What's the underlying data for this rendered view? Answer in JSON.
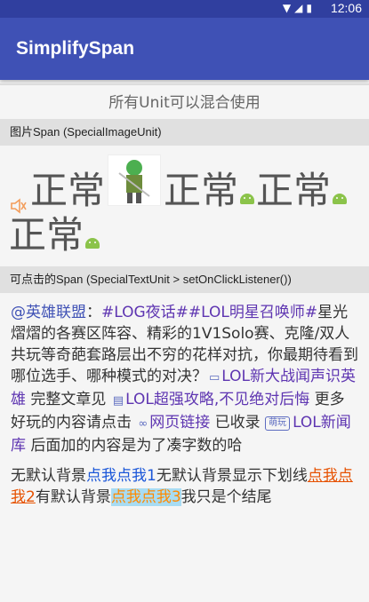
{
  "status_bar": {
    "time": "12:06"
  },
  "app_bar": {
    "title": "SimplifySpan"
  },
  "intro": {
    "text": "所有Unit可以混合使用"
  },
  "sections": {
    "image_span_header": "图片Span (SpecialImageUnit)",
    "image_span": {
      "word": "正常"
    },
    "text_span_header": "可点击的Span (SpecialTextUnit > setOnClickListener())"
  },
  "paragraph1": {
    "tag1": "@英雄联盟",
    "sep1": "：",
    "tag2": "#LOG夜话#",
    "tag3": "#LOL明星召唤师#",
    "text1": "星光熠熠的各赛区阵容、精彩的1V1Solo赛、克隆/双人共玩等奇葩套路层出不穷的花样对抗，你最期待看到哪位选手、哪种模式的对决？",
    "link1": "LOL新大战闻声识英雄",
    "text2": " 完整文章见 ",
    "link2": "LOL超强攻略,不见绝对后悔",
    "text3": " 更多好玩的内容请点击 ",
    "link3": "网页链接",
    "text4": " 已收录 ",
    "badge": "萌玩",
    "link4": "LOL新闻库",
    "text5": " 后面加的内容是为了凑字数的哈"
  },
  "paragraph2": {
    "t1": "无默认背景",
    "l1": "点我点我1",
    "t2": "无默认背景显示下划线",
    "l2": "点我点我2",
    "t3": "有默认背景",
    "l3": "点我点我3",
    "t4": "我只是个结尾"
  }
}
